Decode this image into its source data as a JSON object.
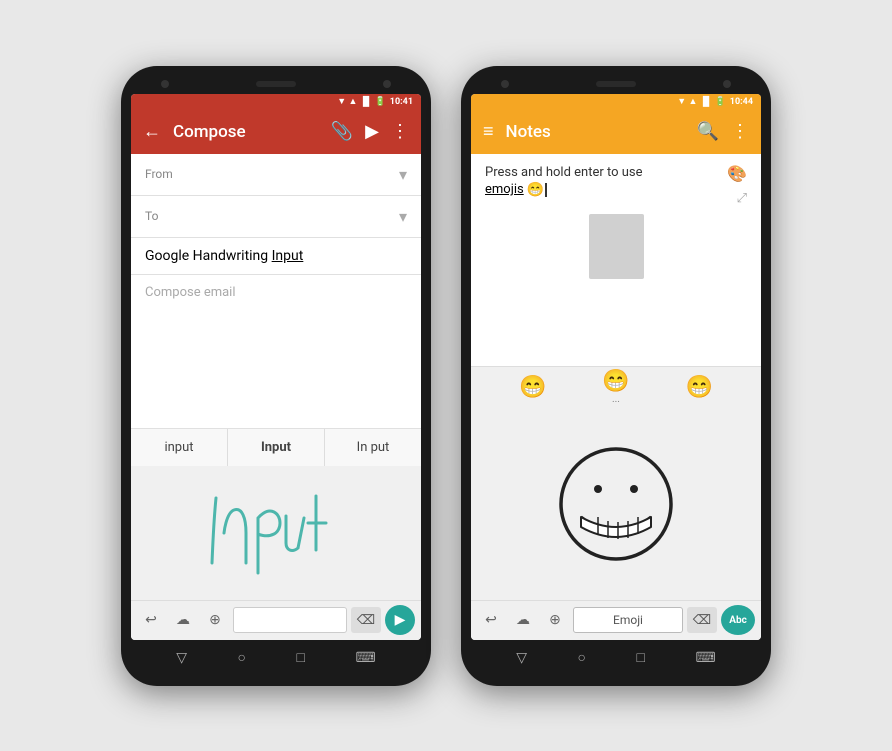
{
  "phone1": {
    "time": "10:41",
    "toolbar": {
      "back_icon": "←",
      "title": "Compose",
      "attach_icon": "📎",
      "send_icon": "▶",
      "more_icon": "⋮"
    },
    "form": {
      "from_label": "From",
      "to_label": "To",
      "subject": "Google Handwriting Input",
      "subject_underline_start": "Google Handwriting ",
      "subject_underline": "Input",
      "compose_placeholder": "Compose email"
    },
    "autocorrect": {
      "items": [
        "input",
        "Input",
        "In put"
      ]
    },
    "keyboard": {
      "undo_icon": "↩",
      "cloud_icon": "☁",
      "globe_icon": "⊕",
      "delete_icon": "⌫",
      "send_icon": "▶"
    },
    "nav": {
      "back": "▽",
      "home": "○",
      "recent": "□",
      "keyboard": "⌨"
    }
  },
  "phone2": {
    "time": "10:44",
    "toolbar": {
      "menu_icon": "≡",
      "title": "Notes",
      "search_icon": "🔍",
      "more_icon": "⋮"
    },
    "note": {
      "text": "Press and hold enter to use emojis",
      "text_line1": "Press and hold enter to use",
      "text_line2": "emojis",
      "cursor": "|",
      "palette_icon": "🎨",
      "expand_icon": "⤢"
    },
    "emojis": {
      "suggestions": [
        "😁",
        "😁",
        "😁"
      ],
      "more": "..."
    },
    "keyboard": {
      "undo_icon": "↩",
      "cloud_icon": "☁",
      "globe_icon": "⊕",
      "emoji_label": "Emoji",
      "delete_icon": "⌫",
      "abc_label": "Abc"
    },
    "nav": {
      "back": "▽",
      "home": "○",
      "recent": "□",
      "keyboard": "⌨"
    }
  }
}
